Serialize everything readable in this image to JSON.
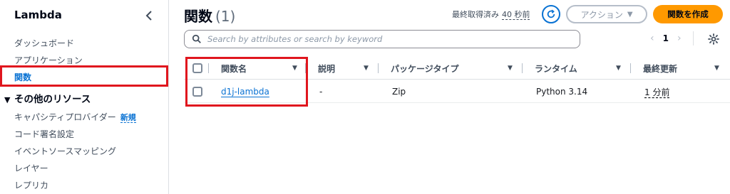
{
  "sidebar": {
    "title": "Lambda",
    "items": [
      {
        "label": "ダッシュボード"
      },
      {
        "label": "アプリケーション"
      },
      {
        "label": "関数"
      }
    ],
    "section_title": "その他のリソース",
    "resources": [
      {
        "label": "キャパシティプロバイダー",
        "badge": "新規"
      },
      {
        "label": "コード署名設定"
      },
      {
        "label": "イベントソースマッピング"
      },
      {
        "label": "レイヤー"
      },
      {
        "label": "レプリカ"
      }
    ]
  },
  "header": {
    "title": "関数",
    "count": "(1)",
    "last_fetched_label": "最終取得済み",
    "last_fetched_value": "40 秒前",
    "actions_label": "アクション",
    "create_label": "関数を作成"
  },
  "search": {
    "placeholder": "Search by attributes or search by keyword",
    "value": ""
  },
  "pagination": {
    "current_page": "1"
  },
  "table": {
    "columns": [
      "関数名",
      "説明",
      "パッケージタイプ",
      "ランタイム",
      "最終更新"
    ],
    "rows": [
      {
        "name": "d1j-lambda",
        "description": "-",
        "package_type": "Zip",
        "runtime": "Python 3.14",
        "last_modified": "1 分前"
      }
    ]
  },
  "colors": {
    "accent": "#0972d3",
    "primary_button": "#ff9900",
    "highlight": "#e0161e"
  }
}
